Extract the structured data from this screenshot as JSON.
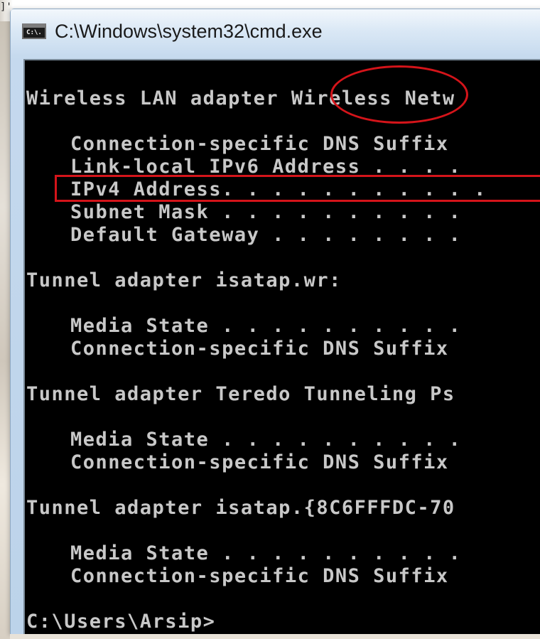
{
  "corner_mark": "]'",
  "window": {
    "title": "C:\\Windows\\system32\\cmd.exe",
    "icon": "cmd-console-icon",
    "icon_label": "C:\\."
  },
  "console": {
    "lines": [
      "Wireless LAN adapter Wireless Netw",
      "Connection-specific DNS Suffix",
      "Link-local IPv6 Address . . . .",
      "IPv4 Address. . . . . . . . . . .",
      "Subnet Mask . . . . . . . . . .",
      "Default Gateway . . . . . . . .",
      "Tunnel adapter isatap.wr:",
      "Media State . . . . . . . . . .",
      "Connection-specific DNS Suffix",
      "Tunnel adapter Teredo Tunneling Ps",
      "Media State . . . . . . . . . .",
      "Connection-specific DNS Suffix",
      "Tunnel adapter isatap.{8C6FFFDC-70",
      "Media State . . . . . . . . . .",
      "Connection-specific DNS Suffix",
      "C:\\Users\\Arsip>"
    ]
  },
  "annotations": {
    "color": "#d4141a",
    "ellipse_target": "Wireless",
    "rect_target": "IPv4 Address"
  }
}
